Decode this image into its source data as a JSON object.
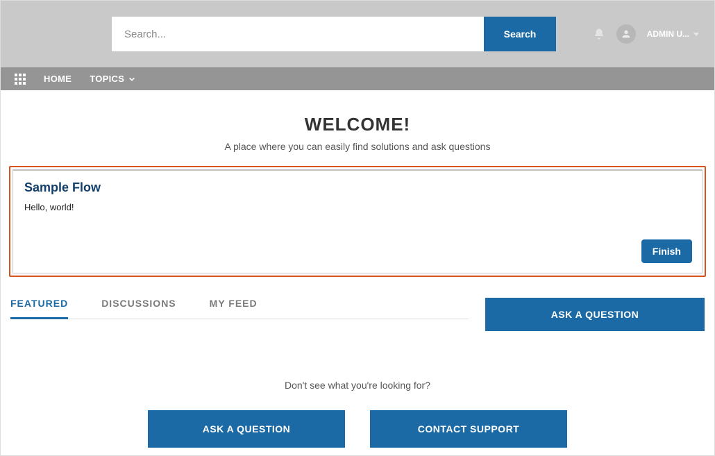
{
  "header": {
    "search_placeholder": "Search...",
    "search_button": "Search",
    "user_label": "ADMIN U..."
  },
  "nav": {
    "home": "HOME",
    "topics": "TOPICS"
  },
  "welcome": {
    "title": "WELCOME!",
    "subtitle": "A place where you can easily find solutions and ask questions"
  },
  "flow": {
    "title": "Sample Flow",
    "body": "Hello, world!",
    "finish": "Finish"
  },
  "tabs": {
    "featured": "FEATURED",
    "discussions": "DISCUSSIONS",
    "my_feed": "MY FEED"
  },
  "actions": {
    "ask_question": "ASK A QUESTION"
  },
  "footer": {
    "prompt": "Don't see what you're looking for?",
    "ask": "ASK A QUESTION",
    "contact": "CONTACT SUPPORT"
  }
}
